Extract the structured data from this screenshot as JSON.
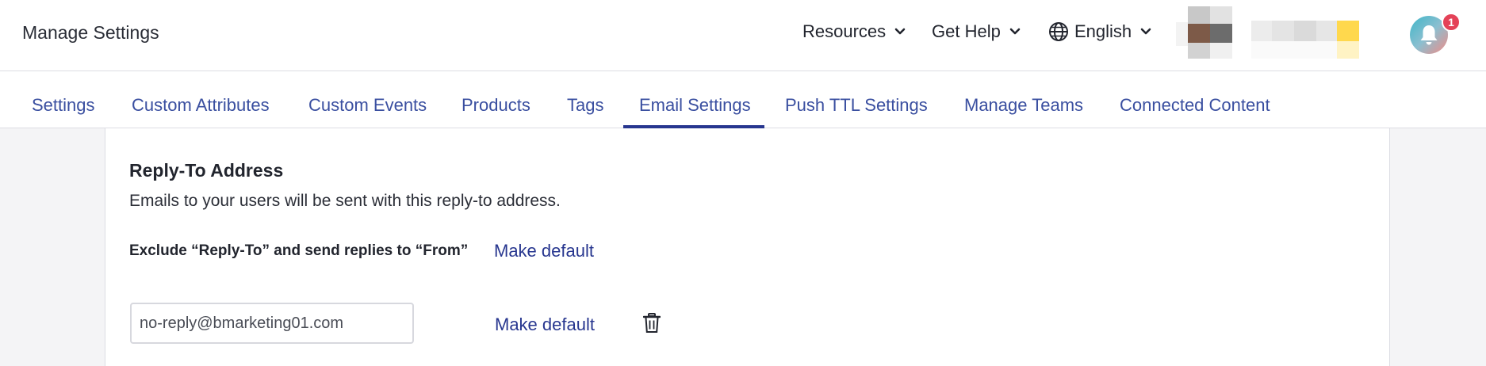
{
  "header": {
    "title": "Manage Settings",
    "menus": [
      {
        "label": "Resources"
      },
      {
        "label": "Get Help"
      },
      {
        "label": "English"
      }
    ],
    "notifications": {
      "count": "1"
    }
  },
  "tabs": [
    {
      "label": "Settings"
    },
    {
      "label": "Custom Attributes"
    },
    {
      "label": "Custom Events"
    },
    {
      "label": "Products"
    },
    {
      "label": "Tags"
    },
    {
      "label": "Email Settings",
      "active": true
    },
    {
      "label": "Push TTL Settings"
    },
    {
      "label": "Manage Teams"
    },
    {
      "label": "Connected Content"
    }
  ],
  "reply_to": {
    "title": "Reply-To Address",
    "description": "Emails to your users will be sent with this reply-to address.",
    "exclude_label": "Exclude “Reply-To” and send replies to “From”",
    "make_default_1": "Make default",
    "email_value": "no-reply@bmarketing01.com",
    "make_default_2": "Make default"
  },
  "colors": {
    "accent": "#27368f",
    "tab_text": "#3a4fa0",
    "badge": "#e44258"
  }
}
